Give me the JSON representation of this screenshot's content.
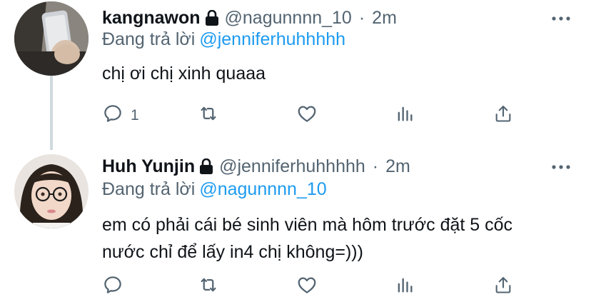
{
  "tweets": [
    {
      "display_name": "kangnawon",
      "handle": "@nagunnnn_10",
      "separator": "·",
      "time": "2m",
      "reply_prefix": "Đang trả lời",
      "reply_mention": "@jenniferhuhhhhh",
      "text": "chị ơi chị xinh quaaa",
      "reply_count": "1",
      "avatar_icon": "avatar-photo",
      "locked": true
    },
    {
      "display_name": "Huh Yunjin",
      "handle": "@jenniferhuhhhhh",
      "separator": "·",
      "time": "2m",
      "reply_prefix": "Đang trả lời",
      "reply_mention": "@nagunnnn_10",
      "text": "em có phải cái bé sinh viên mà hôm trước đặt 5 cốc nước chỉ để lấy in4 chị không=)))",
      "reply_count": "",
      "avatar_icon": "avatar-photo",
      "locked": true
    }
  ],
  "icons": [
    "lock-icon",
    "more-icon",
    "reply-icon",
    "retweet-icon",
    "like-icon",
    "stats-icon",
    "share-icon"
  ],
  "colors": {
    "text": "#0f1419",
    "secondary": "#536471",
    "accent": "#1d9bf0",
    "thread_line": "#cfd9de"
  }
}
